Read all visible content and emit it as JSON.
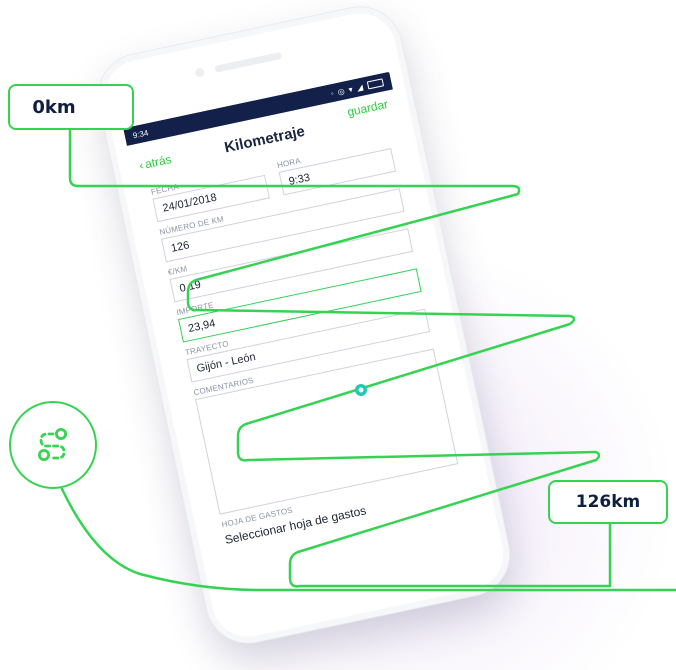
{
  "colors": {
    "accent": "#2ecc40",
    "line_green": "#36d353",
    "statusbar": "#12204a",
    "title": "#1a2340"
  },
  "callouts": {
    "start_km": "0km",
    "end_km": "126km",
    "route_icon": "route-icon"
  },
  "status_bar": {
    "time": "9:34",
    "icons": "◦ ◎ ▾ ◢"
  },
  "nav": {
    "back_label": "atrás",
    "title": "Kilometraje",
    "save_label": "guardar"
  },
  "form": {
    "fecha": {
      "label": "FECHA",
      "value": "24/01/2018"
    },
    "hora": {
      "label": "HORA",
      "value": "9:33"
    },
    "numero_km": {
      "label": "NÚMERO DE KM",
      "value": "126"
    },
    "e_km": {
      "label": "€/KM",
      "value": "0,19"
    },
    "importe": {
      "label": "IMPORTE",
      "value": "23,94"
    },
    "trayecto": {
      "label": "TRAYECTO",
      "value": "Gijón - León"
    },
    "comentarios": {
      "label": "COMENTARIOS",
      "value": ""
    },
    "hoja_gastos": {
      "label": "HOJA DE GASTOS",
      "value": "Seleccionar hoja de gastos"
    }
  }
}
